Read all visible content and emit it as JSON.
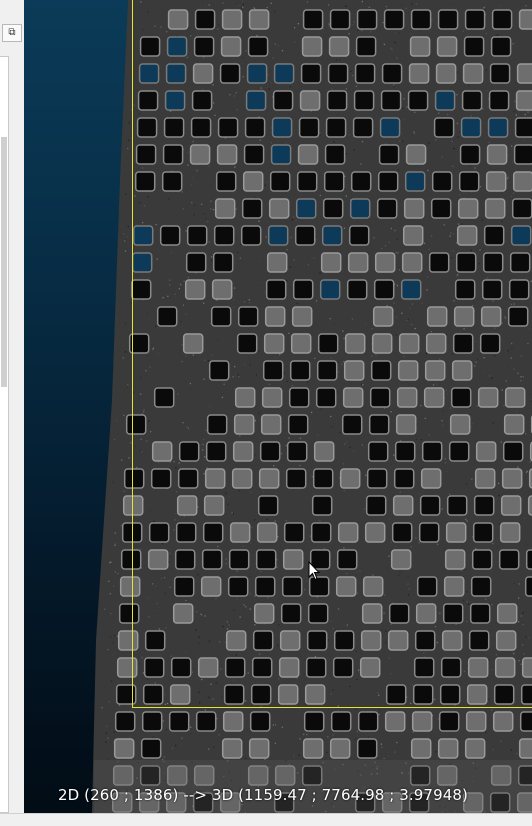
{
  "window": {
    "restore_icon": "restore-window-icon"
  },
  "viewport": {
    "background_top": "#0b3b58",
    "background_bottom": "#020c15",
    "selection_color": "#e6e62a",
    "cursor_icon": "arrow-cursor-icon"
  },
  "coordinates": {
    "two_d": "2D (260 ; 1386)",
    "arrow": "-->",
    "three_d": "3D (1159.47 ; 7764.98 ; 3.97948)"
  }
}
